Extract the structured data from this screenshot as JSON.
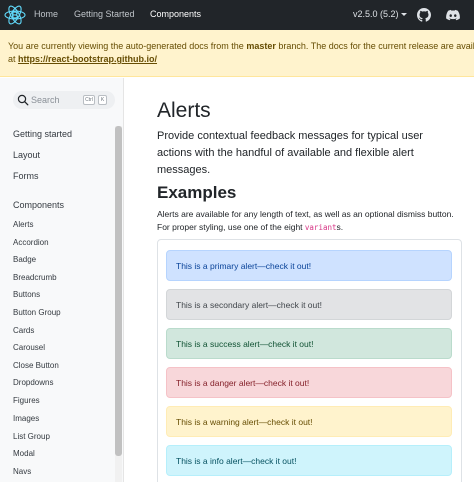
{
  "navbar": {
    "links": [
      "Home",
      "Getting Started",
      "Components"
    ],
    "active": "Components",
    "version": "v2.5.0 (5.2)",
    "logo_icon": "react-bootstrap-logo-icon",
    "icons": [
      "github-icon",
      "discord-icon"
    ],
    "background": "#212529"
  },
  "banner": {
    "text_before": "You are currently viewing the auto-generated docs from the ",
    "branch": "master",
    "text_after": " branch. The docs for the current release are availabl",
    "text_at": "at ",
    "link": "https://react-bootstrap.github.io/",
    "background": "#fff3cd"
  },
  "sidebar": {
    "search_placeholder": "Search",
    "shortcut_keys": [
      "Ctrl",
      "K"
    ],
    "top_items": [
      "Getting started",
      "Layout",
      "Forms"
    ],
    "section": "Components",
    "sub_items": [
      "Alerts",
      "Accordion",
      "Badge",
      "Breadcrumb",
      "Buttons",
      "Button Group",
      "Cards",
      "Carousel",
      "Close Button",
      "Dropdowns",
      "Figures",
      "Images",
      "List Group",
      "Modal",
      "Navs"
    ]
  },
  "main": {
    "title": "Alerts",
    "lead": "Provide contextual feedback messages for typical user actions with the handful of available and flexible alert messages.",
    "section_title": "Examples",
    "para_before": "Alerts are available for any length of text, as well as an optional dismiss button. For proper styling, use one of the eight ",
    "para_code": "variant",
    "para_after": "s.",
    "alerts": [
      {
        "text": "This is a primary alert—check it out!",
        "bg": "#cfe2ff",
        "border": "#b6d4fe",
        "color": "#084298"
      },
      {
        "text": "This is a secondary alert—check it out!",
        "bg": "#e2e3e5",
        "border": "#d3d6d8",
        "color": "#41464b"
      },
      {
        "text": "This is a success alert—check it out!",
        "bg": "#d1e7dd",
        "border": "#badbcc",
        "color": "#0f5132"
      },
      {
        "text": "This is a danger alert—check it out!",
        "bg": "#f8d7da",
        "border": "#f5c2c7",
        "color": "#842029"
      },
      {
        "text": "This is a warning alert—check it out!",
        "bg": "#fff3cd",
        "border": "#ffecb5",
        "color": "#664d03"
      },
      {
        "text": "This is a info alert—check it out!",
        "bg": "#cff4fc",
        "border": "#b6effb",
        "color": "#055160"
      }
    ]
  }
}
